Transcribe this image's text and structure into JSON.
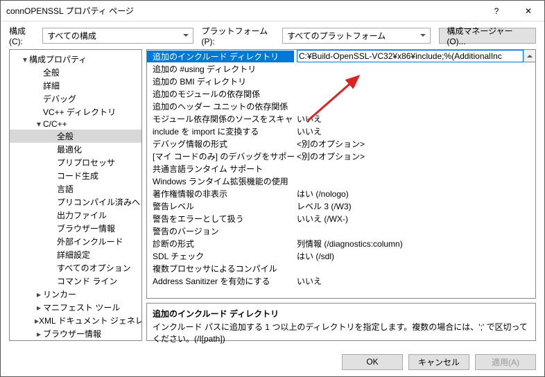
{
  "window": {
    "title": "connOPENSSL プロパティ ページ",
    "help_icon": "?",
    "close_icon": "✕"
  },
  "topbar": {
    "config_label": "構成(C):",
    "config_value": "すべての構成",
    "platform_label": "プラットフォーム(P):",
    "platform_value": "すべてのプラットフォーム",
    "config_mgr": "構成マネージャー(O)..."
  },
  "tree": [
    {
      "lvl": 0,
      "arrow": "▾",
      "label": "構成プロパティ"
    },
    {
      "lvl": 1,
      "arrow": "",
      "label": "全般"
    },
    {
      "lvl": 1,
      "arrow": "",
      "label": "詳細"
    },
    {
      "lvl": 1,
      "arrow": "",
      "label": "デバッグ"
    },
    {
      "lvl": 1,
      "arrow": "",
      "label": "VC++ ディレクトリ"
    },
    {
      "lvl": 1,
      "arrow": "▾",
      "label": "C/C++"
    },
    {
      "lvl": 2,
      "arrow": "",
      "label": "全般",
      "selected": true
    },
    {
      "lvl": 2,
      "arrow": "",
      "label": "最適化"
    },
    {
      "lvl": 2,
      "arrow": "",
      "label": "プリプロセッサ"
    },
    {
      "lvl": 2,
      "arrow": "",
      "label": "コード生成"
    },
    {
      "lvl": 2,
      "arrow": "",
      "label": "言語"
    },
    {
      "lvl": 2,
      "arrow": "",
      "label": "プリコンパイル済みヘッ"
    },
    {
      "lvl": 2,
      "arrow": "",
      "label": "出力ファイル"
    },
    {
      "lvl": 2,
      "arrow": "",
      "label": "ブラウザー情報"
    },
    {
      "lvl": 2,
      "arrow": "",
      "label": "外部インクルード"
    },
    {
      "lvl": 2,
      "arrow": "",
      "label": "詳細設定"
    },
    {
      "lvl": 2,
      "arrow": "",
      "label": "すべてのオプション"
    },
    {
      "lvl": 2,
      "arrow": "",
      "label": "コマンド ライン"
    },
    {
      "lvl": 1,
      "arrow": "▸",
      "label": "リンカー"
    },
    {
      "lvl": 1,
      "arrow": "▸",
      "label": "マニフェスト ツール"
    },
    {
      "lvl": 1,
      "arrow": "▸",
      "label": "XML ドキュメント ジェネレー"
    },
    {
      "lvl": 1,
      "arrow": "▸",
      "label": "ブラウザー情報"
    }
  ],
  "grid": [
    {
      "name": "追加のインクルード ディレクトリ",
      "val": "C:¥Build-OpenSSL-VC32¥x86¥include;%(AdditionalInc",
      "selected": true
    },
    {
      "name": "追加の #using ディレクトリ",
      "val": ""
    },
    {
      "name": "追加の BMI ディレクトリ",
      "val": ""
    },
    {
      "name": "追加のモジュールの依存関係",
      "val": ""
    },
    {
      "name": "追加のヘッダー ユニットの依存関係",
      "val": ""
    },
    {
      "name": "モジュール依存関係のソースをスキャンする",
      "val": "いいえ"
    },
    {
      "name": "include を import に変換する",
      "val": "いいえ"
    },
    {
      "name": "デバッグ情報の形式",
      "val": "<別のオプション>"
    },
    {
      "name": "[マイ コードのみ] のデバッグをサポートする",
      "val": "<別のオプション>"
    },
    {
      "name": "共通言語ランタイム サポート",
      "val": ""
    },
    {
      "name": "Windows ランタイム拡張機能の使用",
      "val": ""
    },
    {
      "name": "著作権情報の非表示",
      "val": "はい (/nologo)"
    },
    {
      "name": "警告レベル",
      "val": "レベル 3 (/W3)"
    },
    {
      "name": "警告をエラーとして扱う",
      "val": "いいえ (/WX-)"
    },
    {
      "name": "警告のバージョン",
      "val": ""
    },
    {
      "name": "診断の形式",
      "val": "列情報 (/diagnostics:column)"
    },
    {
      "name": "SDL チェック",
      "val": "はい (/sdl)"
    },
    {
      "name": "複数プロセッサによるコンパイル",
      "val": ""
    },
    {
      "name": "Address Sanitizer を有効にする",
      "val": "いいえ"
    }
  ],
  "desc": {
    "title": "追加のインクルード ディレクトリ",
    "body": "インクルード パスに追加する 1 つ以上のディレクトリを指定します。複数の場合には、';' で区切ってください。(/I[path])"
  },
  "footer": {
    "ok": "OK",
    "cancel": "キャンセル",
    "apply": "適用(A)"
  }
}
